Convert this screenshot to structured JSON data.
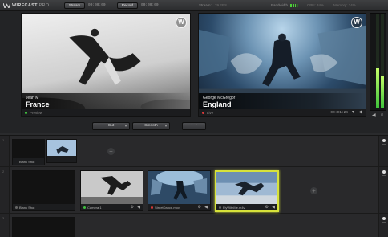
{
  "app": {
    "brand": "WIRECAST",
    "edition": "PRO"
  },
  "topbar": {
    "stream_button": "Stream",
    "stream_time": "00:00:00",
    "record_button": "Record",
    "record_time": "00:00:00",
    "stream_label": "Stream:",
    "fps": "29 FPS",
    "bandwidth_label": "Bandwidth",
    "cpu": "CPU: 34%",
    "memory": "Memory: 34%"
  },
  "preview": {
    "person_name": "Jean M",
    "location": "France",
    "status": "Preview",
    "status_color": "#3fbf3f"
  },
  "live": {
    "person_name": "George McGregor",
    "location": "England",
    "status": "Live",
    "status_color": "#d63a3a",
    "time": "00:01:24"
  },
  "transitions": {
    "cut_label": "Cut",
    "smooth_label": "Smooth",
    "go_icon": "double-arrow-icon"
  },
  "audio": {
    "left_level": 0.42,
    "right_level": 0.35
  },
  "shots": {
    "row1": [
      {
        "name": "Blank Shot"
      },
      {
        "name": ""
      }
    ],
    "row2": [
      {
        "name": "Blank Shot",
        "status_color": "#666666"
      },
      {
        "name": "Camera 1",
        "status_color": "#3fbf3f"
      },
      {
        "name": "StreetDance.mov",
        "status_color": "#d63a3a"
      },
      {
        "name": "FlyWithMe.m4v",
        "status_color": "#666666",
        "selected": true
      }
    ]
  }
}
